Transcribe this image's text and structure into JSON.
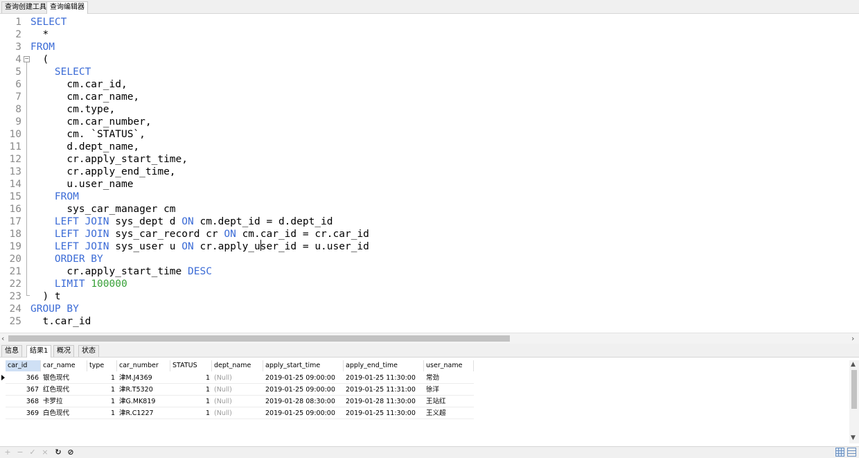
{
  "tabs": [
    {
      "label": "查询创建工具"
    },
    {
      "label": "查询编辑器"
    }
  ],
  "editor": {
    "lines": [
      {
        "num": "1",
        "indent": "",
        "tokens": [
          {
            "t": "SELECT",
            "k": "kw"
          }
        ]
      },
      {
        "num": "2",
        "indent": "  ",
        "tokens": [
          {
            "t": "*",
            "k": ""
          }
        ]
      },
      {
        "num": "3",
        "indent": "",
        "tokens": [
          {
            "t": "FROM",
            "k": "kw"
          }
        ]
      },
      {
        "num": "4",
        "indent": "  ",
        "tokens": [
          {
            "t": "(",
            "k": ""
          }
        ]
      },
      {
        "num": "5",
        "indent": "    ",
        "tokens": [
          {
            "t": "SELECT",
            "k": "kw"
          }
        ]
      },
      {
        "num": "6",
        "indent": "      ",
        "tokens": [
          {
            "t": "cm.car_id,",
            "k": ""
          }
        ]
      },
      {
        "num": "7",
        "indent": "      ",
        "tokens": [
          {
            "t": "cm.car_name,",
            "k": ""
          }
        ]
      },
      {
        "num": "8",
        "indent": "      ",
        "tokens": [
          {
            "t": "cm.type,",
            "k": ""
          }
        ]
      },
      {
        "num": "9",
        "indent": "      ",
        "tokens": [
          {
            "t": "cm.car_number,",
            "k": ""
          }
        ]
      },
      {
        "num": "10",
        "indent": "      ",
        "tokens": [
          {
            "t": "cm. `STATUS`,",
            "k": ""
          }
        ]
      },
      {
        "num": "11",
        "indent": "      ",
        "tokens": [
          {
            "t": "d.dept_name,",
            "k": ""
          }
        ]
      },
      {
        "num": "12",
        "indent": "      ",
        "tokens": [
          {
            "t": "cr.apply_start_time,",
            "k": ""
          }
        ]
      },
      {
        "num": "13",
        "indent": "      ",
        "tokens": [
          {
            "t": "cr.apply_end_time,",
            "k": ""
          }
        ]
      },
      {
        "num": "14",
        "indent": "      ",
        "tokens": [
          {
            "t": "u.user_name",
            "k": ""
          }
        ]
      },
      {
        "num": "15",
        "indent": "    ",
        "tokens": [
          {
            "t": "FROM",
            "k": "kw"
          }
        ]
      },
      {
        "num": "16",
        "indent": "      ",
        "tokens": [
          {
            "t": "sys_car_manager cm",
            "k": ""
          }
        ]
      },
      {
        "num": "17",
        "indent": "    ",
        "tokens": [
          {
            "t": "LEFT JOIN",
            "k": "kw"
          },
          {
            "t": " sys_dept d ",
            "k": ""
          },
          {
            "t": "ON",
            "k": "kw"
          },
          {
            "t": " cm.dept_id = d.dept_id",
            "k": ""
          }
        ]
      },
      {
        "num": "18",
        "indent": "    ",
        "tokens": [
          {
            "t": "LEFT JOIN",
            "k": "kw"
          },
          {
            "t": " sys_car_record cr ",
            "k": ""
          },
          {
            "t": "ON",
            "k": "kw"
          },
          {
            "t": " cm.car_id = cr.car_id",
            "k": ""
          }
        ]
      },
      {
        "num": "19",
        "indent": "    ",
        "tokens": [
          {
            "t": "LEFT JOIN",
            "k": "kw"
          },
          {
            "t": " sys_user u ",
            "k": ""
          },
          {
            "t": "ON",
            "k": "kw"
          },
          {
            "t": " cr.apply_user_id = u.user_id",
            "k": ""
          }
        ]
      },
      {
        "num": "20",
        "indent": "    ",
        "tokens": [
          {
            "t": "ORDER BY",
            "k": "kw"
          }
        ]
      },
      {
        "num": "21",
        "indent": "      ",
        "tokens": [
          {
            "t": "cr.apply_start_time ",
            "k": ""
          },
          {
            "t": "DESC",
            "k": "kw"
          }
        ]
      },
      {
        "num": "22",
        "indent": "    ",
        "tokens": [
          {
            "t": "LIMIT",
            "k": "kw"
          },
          {
            "t": " ",
            "k": ""
          },
          {
            "t": "100000",
            "k": "num"
          }
        ]
      },
      {
        "num": "23",
        "indent": "  ",
        "tokens": [
          {
            "t": ") t",
            "k": ""
          }
        ]
      },
      {
        "num": "24",
        "indent": "",
        "tokens": [
          {
            "t": "GROUP BY",
            "k": "kw"
          }
        ]
      },
      {
        "num": "25",
        "indent": "  ",
        "tokens": [
          {
            "t": "t.car_id",
            "k": ""
          }
        ]
      }
    ],
    "colors": {
      "keyword": "#3b6bd6",
      "number": "#38a038",
      "line_number": "#8a8a8a"
    }
  },
  "result_tabs": [
    {
      "label": "信息"
    },
    {
      "label": "结果1"
    },
    {
      "label": "概况"
    },
    {
      "label": "状态"
    }
  ],
  "grid": {
    "columns": [
      "car_id",
      "car_name",
      "type",
      "car_number",
      "STATUS",
      "dept_name",
      "apply_start_time",
      "apply_end_time",
      "user_name"
    ],
    "rows": [
      [
        "366",
        "银色现代",
        "1",
        "津M.J4369",
        "1",
        "(Null)",
        "2019-01-25 09:00:00",
        "2019-01-25 11:30:00",
        "常劲"
      ],
      [
        "367",
        "红色现代",
        "1",
        "津R.T5320",
        "1",
        "(Null)",
        "2019-01-25 09:00:00",
        "2019-01-25 11:31:00",
        "徐洋"
      ],
      [
        "368",
        "卡罗拉",
        "1",
        "津G.MK819",
        "1",
        "(Null)",
        "2019-01-28 08:30:00",
        "2019-01-28 11:30:00",
        "王站红"
      ],
      [
        "369",
        "白色现代",
        "1",
        "津R.C1227",
        "1",
        "(Null)",
        "2019-01-25 09:00:00",
        "2019-01-25 11:30:00",
        "王义超"
      ]
    ]
  },
  "toolbar": {
    "add": "+",
    "remove": "−",
    "apply": "✓",
    "discard": "×",
    "refresh": "↻",
    "stop": "⊘"
  }
}
